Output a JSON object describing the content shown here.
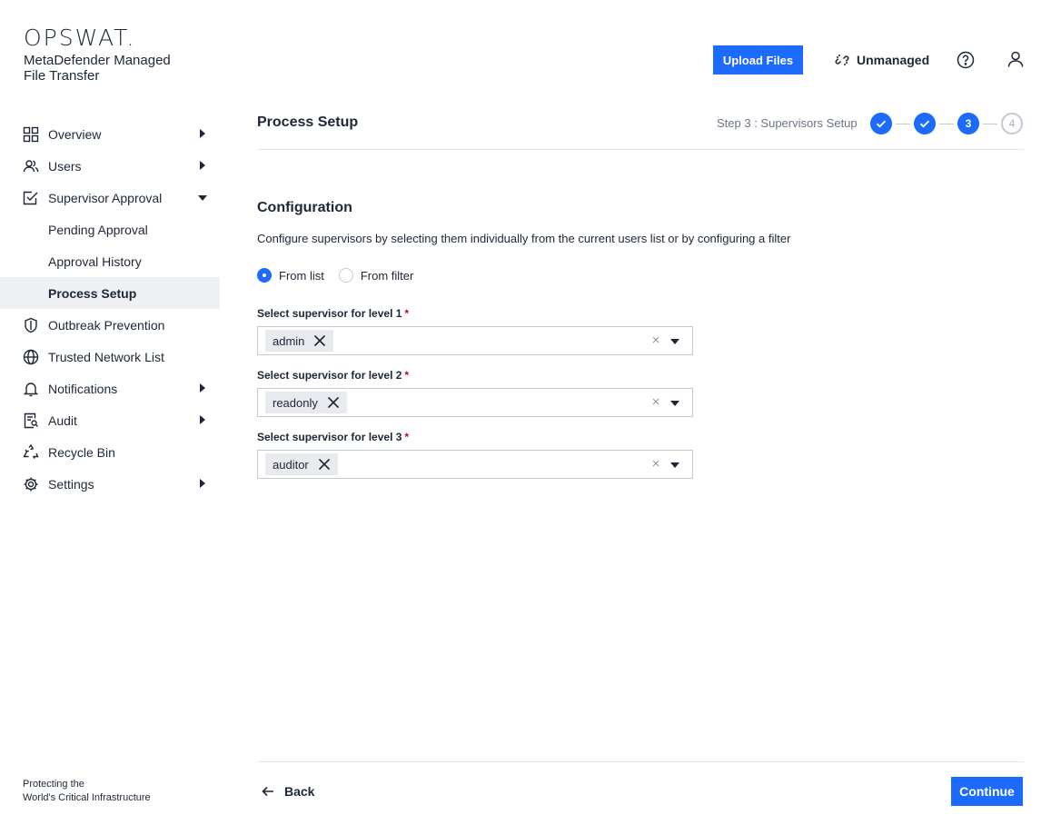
{
  "brand": {
    "logo_text": "OPSWAT.",
    "product_name": "MetaDefender Managed File Transfer",
    "tagline_line1": "Protecting the",
    "tagline_line2": "World's Critical Infrastructure"
  },
  "sidebar": {
    "items": [
      {
        "label": "Overview",
        "icon": "grid-icon",
        "expandable": true,
        "expanded": false
      },
      {
        "label": "Users",
        "icon": "users-icon",
        "expandable": true,
        "expanded": false
      },
      {
        "label": "Supervisor Approval",
        "icon": "approval-check-icon",
        "expandable": true,
        "expanded": true,
        "children": [
          {
            "label": "Pending Approval",
            "active": false
          },
          {
            "label": "Approval History",
            "active": false
          },
          {
            "label": "Process Setup",
            "active": true
          }
        ]
      },
      {
        "label": "Outbreak Prevention",
        "icon": "shield-icon",
        "expandable": false
      },
      {
        "label": "Trusted Network List",
        "icon": "globe-icon",
        "expandable": false
      },
      {
        "label": "Notifications",
        "icon": "bell-icon",
        "expandable": true,
        "expanded": false
      },
      {
        "label": "Audit",
        "icon": "audit-icon",
        "expandable": true,
        "expanded": false
      },
      {
        "label": "Recycle Bin",
        "icon": "recycle-icon",
        "expandable": false
      },
      {
        "label": "Settings",
        "icon": "gear-icon",
        "expandable": true,
        "expanded": false
      }
    ]
  },
  "topbar": {
    "upload_label": "Upload Files",
    "unmanaged_label": "Unmanaged",
    "unmanaged_icon": "link-broken-icon",
    "help_icon": "help-circle-icon",
    "user_icon": "user-icon"
  },
  "header": {
    "title": "Process Setup",
    "step_label": "Step 3 : Supervisors Setup",
    "steps": [
      {
        "state": "done",
        "text": ""
      },
      {
        "state": "done",
        "text": ""
      },
      {
        "state": "current",
        "text": "3"
      },
      {
        "state": "todo",
        "text": "4"
      }
    ]
  },
  "config": {
    "title": "Configuration",
    "description": "Configure supervisors by selecting them individually from the current users list or by configuring a filter",
    "mode_options": [
      {
        "label": "From list",
        "selected": true
      },
      {
        "label": "From filter",
        "selected": false
      }
    ],
    "levels": [
      {
        "label": "Select supervisor for level 1",
        "required_mark": "*",
        "value": "admin"
      },
      {
        "label": "Select supervisor for level 2",
        "required_mark": "*",
        "value": "readonly"
      },
      {
        "label": "Select supervisor for level 3",
        "required_mark": "*",
        "value": "auditor"
      }
    ],
    "clear_glyph": "×"
  },
  "footer": {
    "back_label": "Back",
    "continue_label": "Continue"
  },
  "colors": {
    "accent": "#1d6bfc",
    "text": "#1d2737",
    "muted": "#6b7384",
    "active_nav_bg": "#eef0f4",
    "required": "#d0021b"
  }
}
